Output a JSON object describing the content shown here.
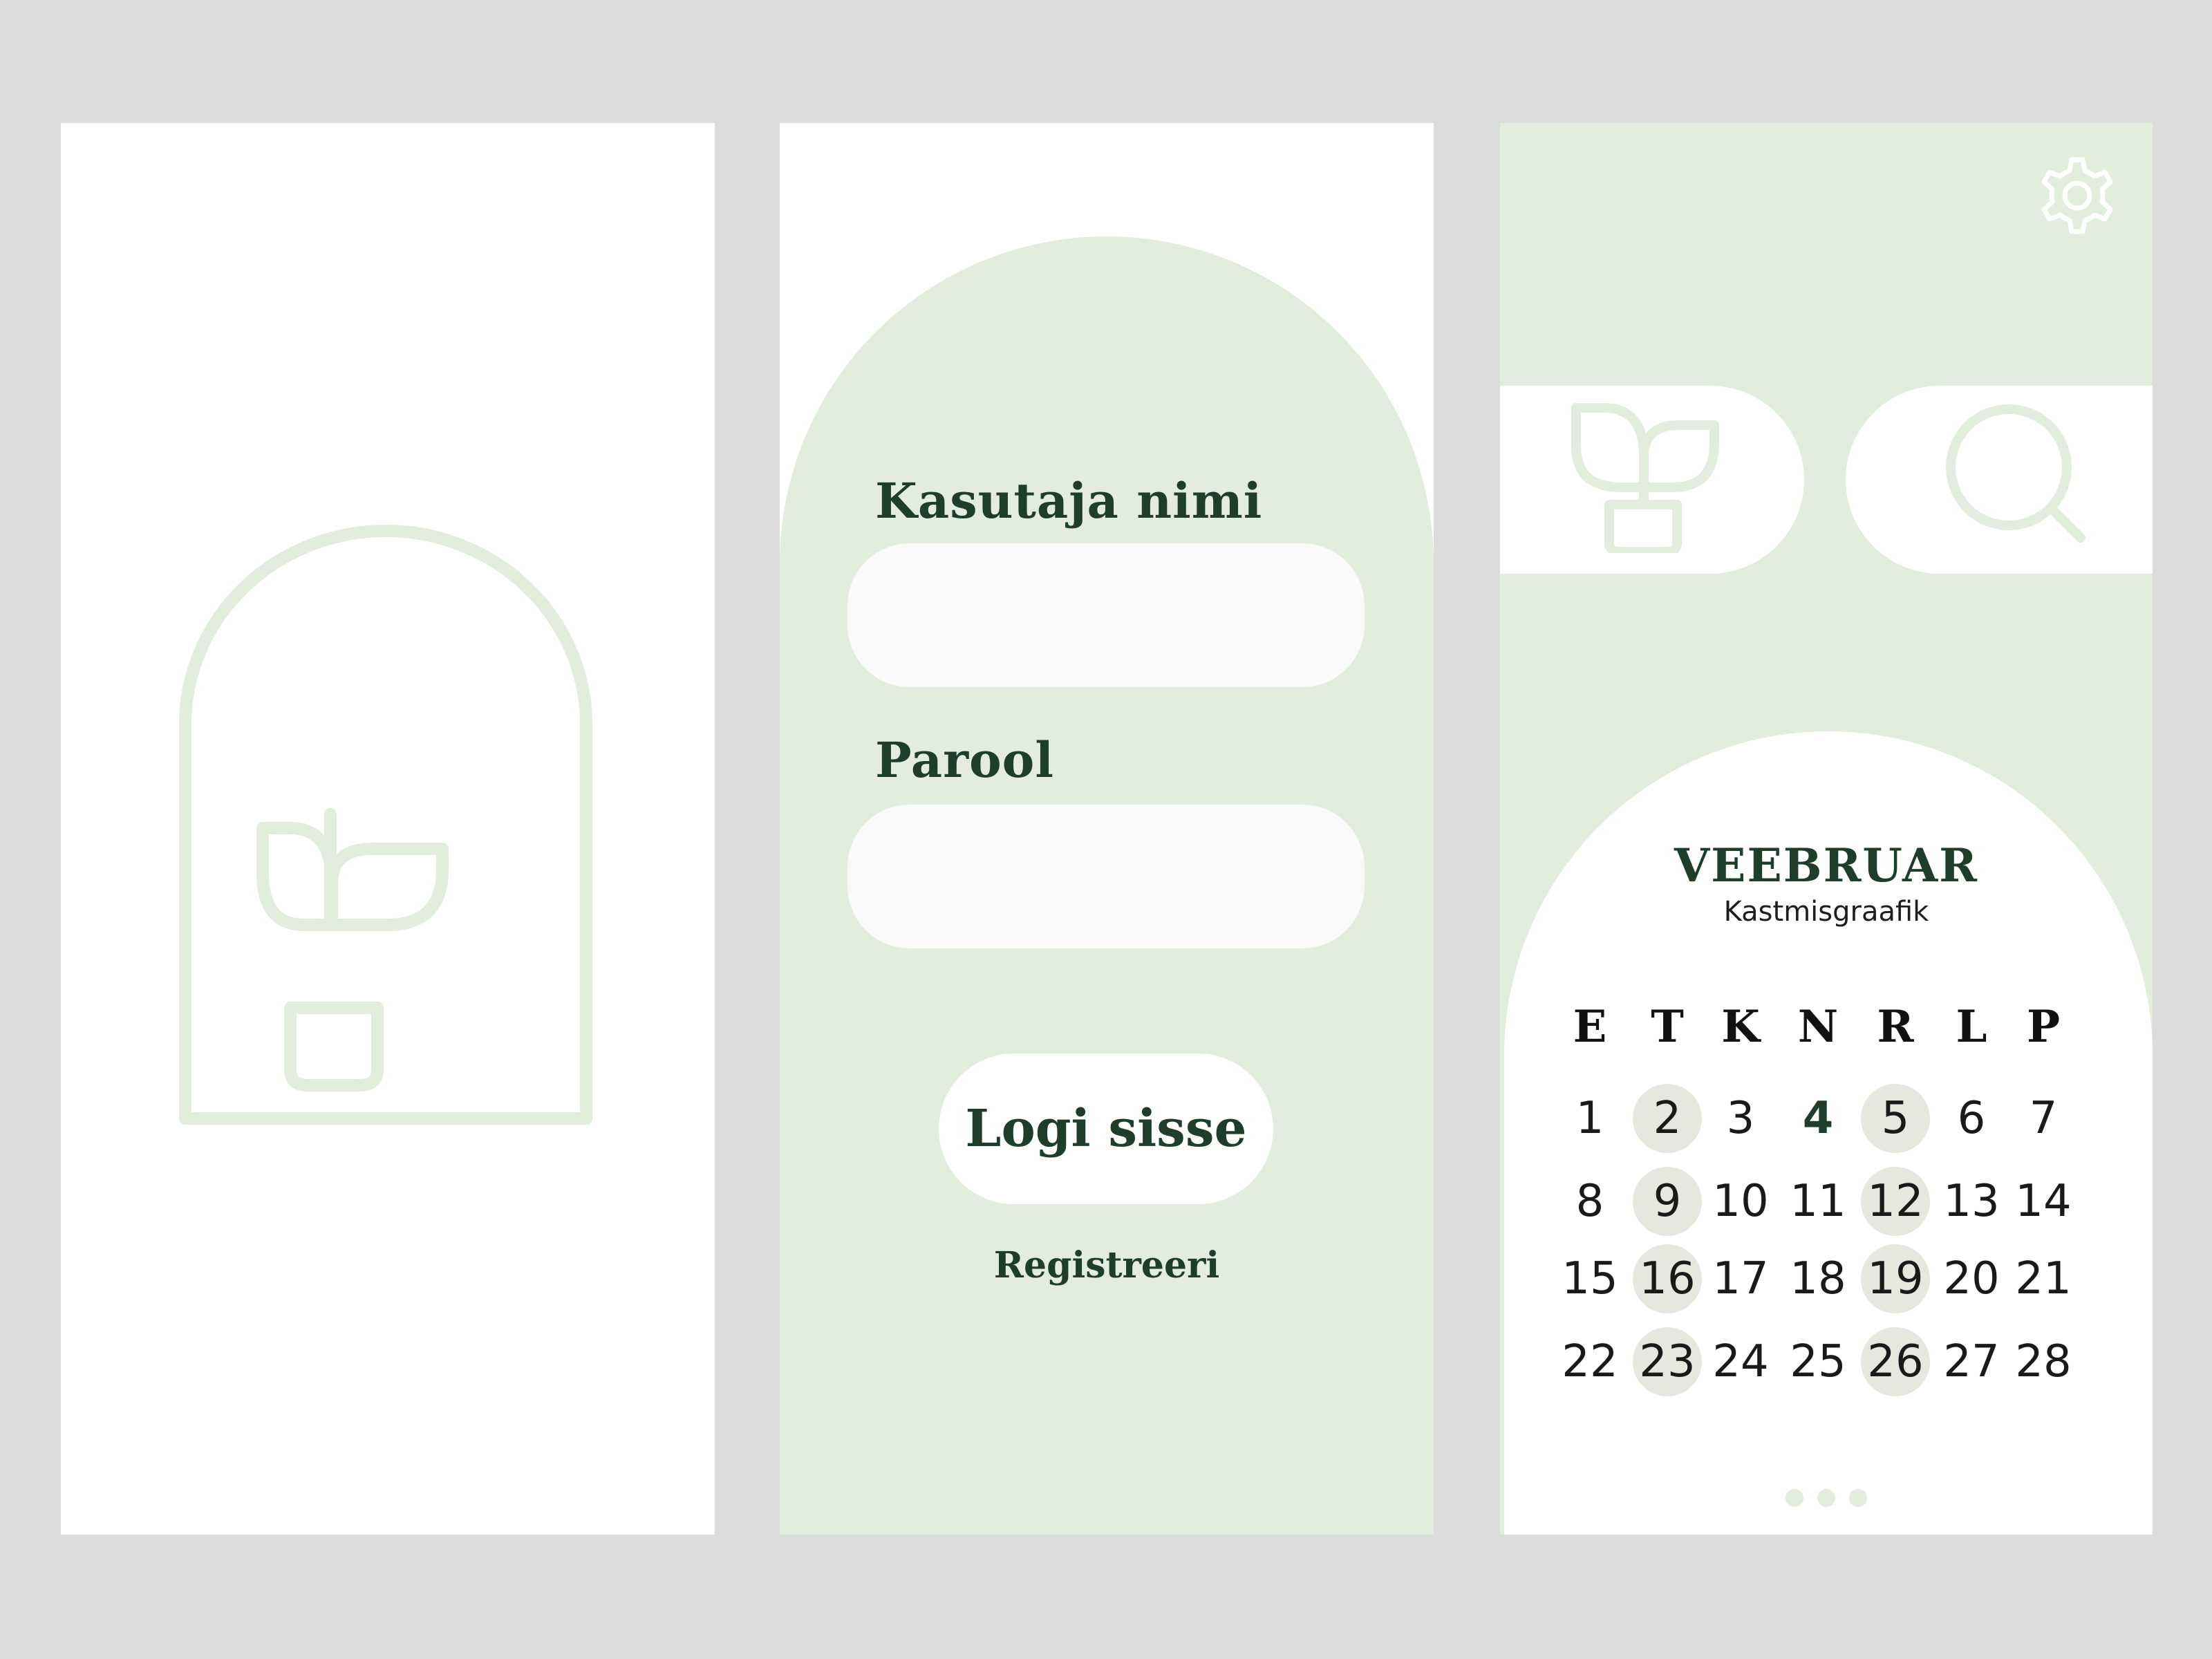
{
  "splash": {
    "logo_icon": "plant-arch-icon"
  },
  "login": {
    "username_label": "Kasutaja nimi",
    "username_value": "",
    "password_label": "Parool",
    "password_value": "",
    "login_button": "Logi sisse",
    "register_link": "Registreeri"
  },
  "home": {
    "settings_icon": "gear-icon",
    "nav": [
      {
        "icon": "plant-icon"
      },
      {
        "icon": "search-icon"
      }
    ],
    "calendar": {
      "month": "VEEBRUAR",
      "subtitle": "Kastmisgraafik",
      "weekdays": [
        "E",
        "T",
        "K",
        "N",
        "R",
        "L",
        "P"
      ],
      "weeks": [
        [
          "1",
          "2",
          "3",
          "4",
          "5",
          "6",
          "7"
        ],
        [
          "8",
          "9",
          "10",
          "11",
          "12",
          "13",
          "14"
        ],
        [
          "15",
          "16",
          "17",
          "18",
          "19",
          "20",
          "21"
        ],
        [
          "22",
          "23",
          "24",
          "25",
          "26",
          "27",
          "28"
        ]
      ],
      "watering_days": [
        "2",
        "5",
        "9",
        "12",
        "16",
        "19",
        "23",
        "26"
      ],
      "today": "4"
    },
    "page_dots": 3
  },
  "colors": {
    "background": "#dcdcdc",
    "mint": "#e2eddd",
    "dark_green": "#1e3d2b",
    "marked_day": "#e8e7df",
    "field": "#fafafa"
  }
}
